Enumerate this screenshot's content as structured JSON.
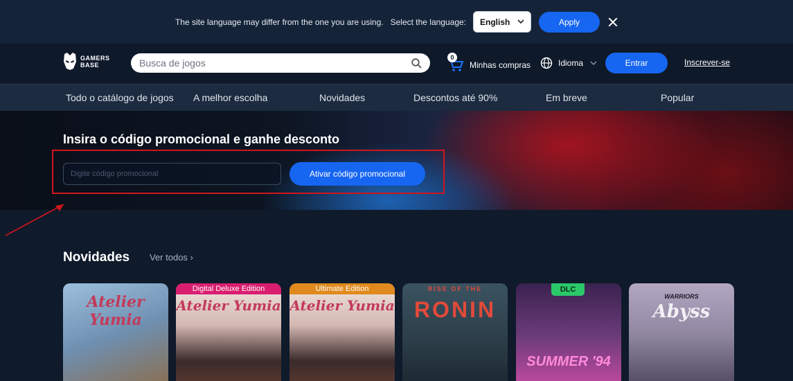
{
  "langbar": {
    "message": "The site language may differ from the one you are using.",
    "select_label": "Select the language:",
    "selected_language": "English",
    "apply": "Apply"
  },
  "header": {
    "logo_line1": "GAMERS",
    "logo_line2": "BASE",
    "search_placeholder": "Busca de jogos",
    "cart_count": "0",
    "cart_label": "Minhas compras",
    "language_label": "Idioma",
    "login": "Entrar",
    "signup": "Inscrever-se"
  },
  "nav": {
    "items": [
      "Todo o catálogo de jogos",
      "A melhor escolha",
      "Novidades",
      "Descontos até 90%",
      "Em breve",
      "Popular"
    ]
  },
  "promo": {
    "title": "Insira o código promocional e ganhe desconto",
    "placeholder": "Digite código promocional",
    "button": "Ativar código promocional"
  },
  "novidades": {
    "title": "Novidades",
    "see_all": "Ver todos ›",
    "cards": [
      {
        "tag": "",
        "title": "Atelier Yumia",
        "color": "#7fa5c7"
      },
      {
        "tag": "Digital Deluxe Edition",
        "title": "Atelier Yumia",
        "color": "#e4d3cf"
      },
      {
        "tag": "Ultimate Edition",
        "title": "Atelier Yumia",
        "color": "#e4d3cf"
      },
      {
        "tag": "RISE OF THE",
        "title": "RONIN",
        "color": "#2d4350"
      },
      {
        "tag": "DLC",
        "title": "SUMMER '94",
        "color": "#6a3b78"
      },
      {
        "tag": "WARRIORS",
        "title": "Abyss",
        "color": "#8f86a0"
      }
    ]
  }
}
